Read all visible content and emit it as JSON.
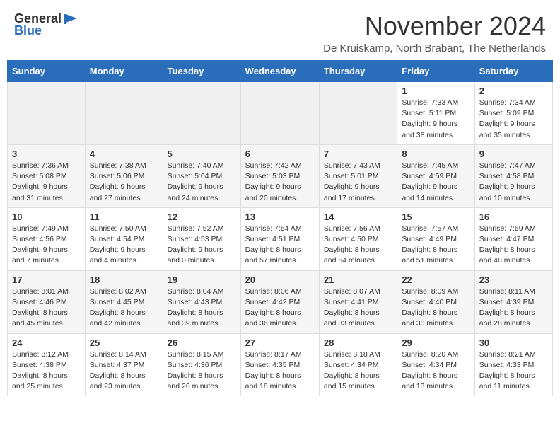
{
  "header": {
    "logo_general": "General",
    "logo_blue": "Blue",
    "title": "November 2024",
    "subtitle": "De Kruiskamp, North Brabant, The Netherlands"
  },
  "days_of_week": [
    "Sunday",
    "Monday",
    "Tuesday",
    "Wednesday",
    "Thursday",
    "Friday",
    "Saturday"
  ],
  "weeks": [
    [
      {
        "day": "",
        "info": ""
      },
      {
        "day": "",
        "info": ""
      },
      {
        "day": "",
        "info": ""
      },
      {
        "day": "",
        "info": ""
      },
      {
        "day": "",
        "info": ""
      },
      {
        "day": "1",
        "info": "Sunrise: 7:33 AM\nSunset: 5:11 PM\nDaylight: 9 hours and 38 minutes."
      },
      {
        "day": "2",
        "info": "Sunrise: 7:34 AM\nSunset: 5:09 PM\nDaylight: 9 hours and 35 minutes."
      }
    ],
    [
      {
        "day": "3",
        "info": "Sunrise: 7:36 AM\nSunset: 5:08 PM\nDaylight: 9 hours and 31 minutes."
      },
      {
        "day": "4",
        "info": "Sunrise: 7:38 AM\nSunset: 5:06 PM\nDaylight: 9 hours and 27 minutes."
      },
      {
        "day": "5",
        "info": "Sunrise: 7:40 AM\nSunset: 5:04 PM\nDaylight: 9 hours and 24 minutes."
      },
      {
        "day": "6",
        "info": "Sunrise: 7:42 AM\nSunset: 5:03 PM\nDaylight: 9 hours and 20 minutes."
      },
      {
        "day": "7",
        "info": "Sunrise: 7:43 AM\nSunset: 5:01 PM\nDaylight: 9 hours and 17 minutes."
      },
      {
        "day": "8",
        "info": "Sunrise: 7:45 AM\nSunset: 4:59 PM\nDaylight: 9 hours and 14 minutes."
      },
      {
        "day": "9",
        "info": "Sunrise: 7:47 AM\nSunset: 4:58 PM\nDaylight: 9 hours and 10 minutes."
      }
    ],
    [
      {
        "day": "10",
        "info": "Sunrise: 7:49 AM\nSunset: 4:56 PM\nDaylight: 9 hours and 7 minutes."
      },
      {
        "day": "11",
        "info": "Sunrise: 7:50 AM\nSunset: 4:54 PM\nDaylight: 9 hours and 4 minutes."
      },
      {
        "day": "12",
        "info": "Sunrise: 7:52 AM\nSunset: 4:53 PM\nDaylight: 9 hours and 0 minutes."
      },
      {
        "day": "13",
        "info": "Sunrise: 7:54 AM\nSunset: 4:51 PM\nDaylight: 8 hours and 57 minutes."
      },
      {
        "day": "14",
        "info": "Sunrise: 7:56 AM\nSunset: 4:50 PM\nDaylight: 8 hours and 54 minutes."
      },
      {
        "day": "15",
        "info": "Sunrise: 7:57 AM\nSunset: 4:49 PM\nDaylight: 8 hours and 51 minutes."
      },
      {
        "day": "16",
        "info": "Sunrise: 7:59 AM\nSunset: 4:47 PM\nDaylight: 8 hours and 48 minutes."
      }
    ],
    [
      {
        "day": "17",
        "info": "Sunrise: 8:01 AM\nSunset: 4:46 PM\nDaylight: 8 hours and 45 minutes."
      },
      {
        "day": "18",
        "info": "Sunrise: 8:02 AM\nSunset: 4:45 PM\nDaylight: 8 hours and 42 minutes."
      },
      {
        "day": "19",
        "info": "Sunrise: 8:04 AM\nSunset: 4:43 PM\nDaylight: 8 hours and 39 minutes."
      },
      {
        "day": "20",
        "info": "Sunrise: 8:06 AM\nSunset: 4:42 PM\nDaylight: 8 hours and 36 minutes."
      },
      {
        "day": "21",
        "info": "Sunrise: 8:07 AM\nSunset: 4:41 PM\nDaylight: 8 hours and 33 minutes."
      },
      {
        "day": "22",
        "info": "Sunrise: 8:09 AM\nSunset: 4:40 PM\nDaylight: 8 hours and 30 minutes."
      },
      {
        "day": "23",
        "info": "Sunrise: 8:11 AM\nSunset: 4:39 PM\nDaylight: 8 hours and 28 minutes."
      }
    ],
    [
      {
        "day": "24",
        "info": "Sunrise: 8:12 AM\nSunset: 4:38 PM\nDaylight: 8 hours and 25 minutes."
      },
      {
        "day": "25",
        "info": "Sunrise: 8:14 AM\nSunset: 4:37 PM\nDaylight: 8 hours and 23 minutes."
      },
      {
        "day": "26",
        "info": "Sunrise: 8:15 AM\nSunset: 4:36 PM\nDaylight: 8 hours and 20 minutes."
      },
      {
        "day": "27",
        "info": "Sunrise: 8:17 AM\nSunset: 4:35 PM\nDaylight: 8 hours and 18 minutes."
      },
      {
        "day": "28",
        "info": "Sunrise: 8:18 AM\nSunset: 4:34 PM\nDaylight: 8 hours and 15 minutes."
      },
      {
        "day": "29",
        "info": "Sunrise: 8:20 AM\nSunset: 4:34 PM\nDaylight: 8 hours and 13 minutes."
      },
      {
        "day": "30",
        "info": "Sunrise: 8:21 AM\nSunset: 4:33 PM\nDaylight: 8 hours and 11 minutes."
      }
    ]
  ]
}
